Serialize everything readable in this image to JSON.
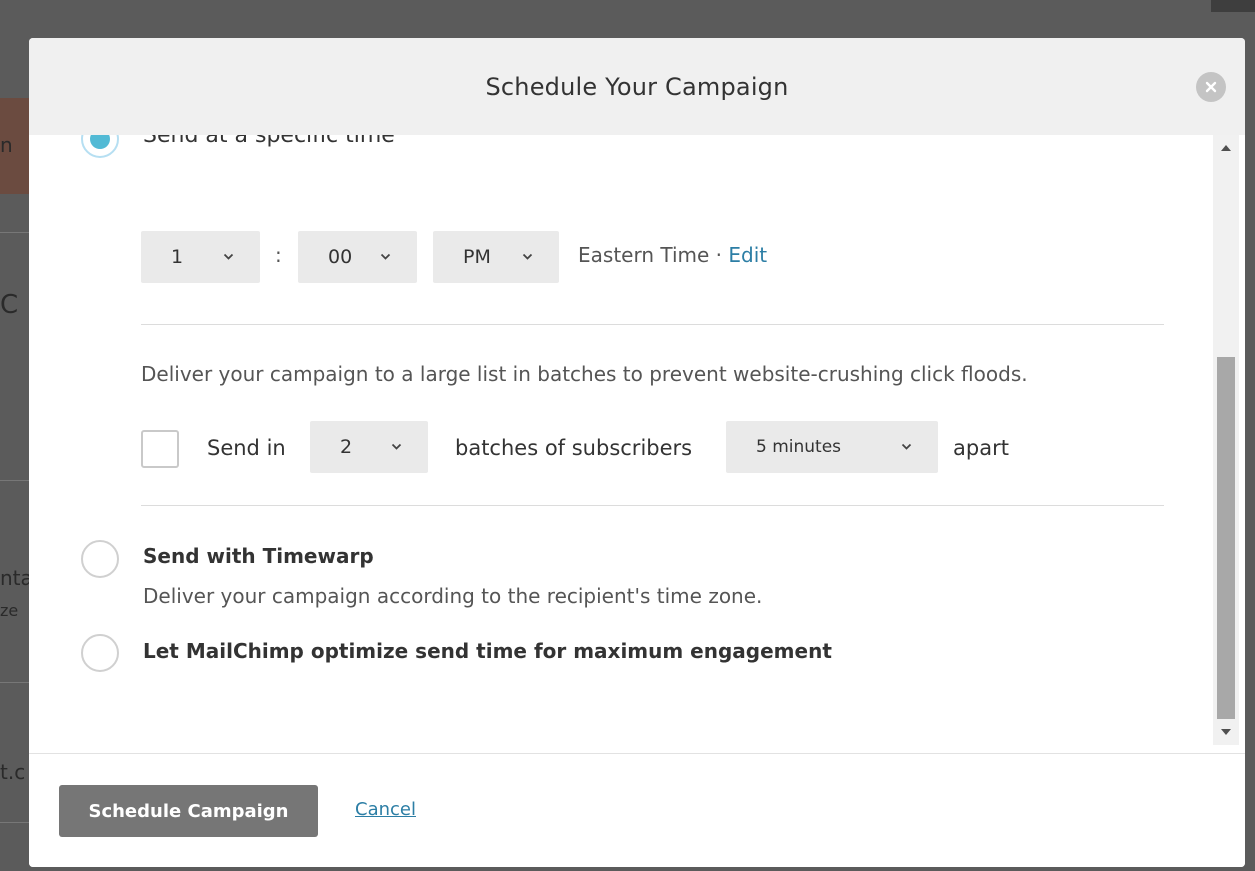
{
  "modal": {
    "title": "Schedule Your Campaign"
  },
  "specific_time": {
    "label": "Send at a specific time",
    "selected": true,
    "hour": "1",
    "minute": "00",
    "ampm": "PM",
    "separator": ":",
    "timezone": "Eastern Time",
    "timezone_sep": " · ",
    "edit_label": "Edit"
  },
  "batch": {
    "description": "Deliver your campaign to a large list in batches to prevent website-crushing click floods.",
    "checked": false,
    "send_in_label": "Send in",
    "batch_count": "2",
    "batches_label": "batches of subscribers",
    "interval": "5 minutes",
    "apart_label": "apart"
  },
  "timewarp": {
    "label": "Send with Timewarp",
    "description": "Deliver your campaign according to the recipient's time zone.",
    "selected": false
  },
  "optimize": {
    "label": "Let MailChimp optimize send time for maximum engagement",
    "selected": false
  },
  "footer": {
    "primary_label": "Schedule Campaign",
    "cancel_label": "Cancel"
  },
  "background": {
    "frag_1": "n",
    "frag_2": "C",
    "frag_3": "nta",
    "frag_4": "ze",
    "frag_5": "t.c"
  },
  "colors": {
    "accent": "#52bad5",
    "link": "#2c7ea5",
    "primary_button": "#767676",
    "header_bg": "#f0f0f0"
  }
}
